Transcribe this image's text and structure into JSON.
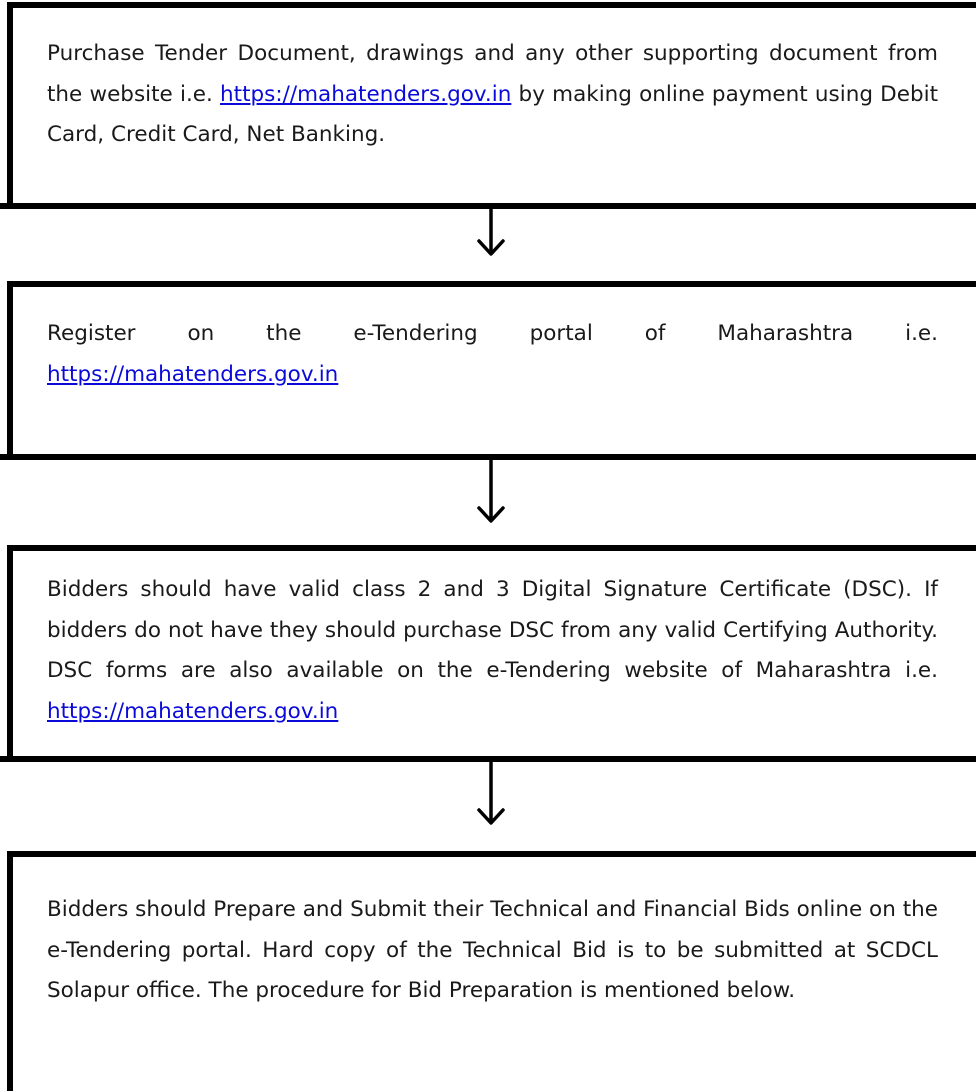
{
  "steps": [
    {
      "text_before": "Purchase Tender Document, drawings and any other supporting document from the website i.e. ",
      "link": "https://mahatenders.gov.in",
      "text_after": " by making online payment using Debit Card, Credit Card, Net Banking."
    },
    {
      "line1": "Register on the e-Tendering portal of Maharashtra i.e.",
      "link": "https://mahatenders.gov.in"
    },
    {
      "text_before": "Bidders should have valid class 2 and 3 Digital Signature Certificate (DSC). If bidders do not have they should purchase DSC from any valid Certifying Authority. DSC forms are also available on the e-Tendering website of Maharashtra i.e. ",
      "link": "https://mahatenders.gov.in"
    },
    {
      "text": "Bidders should Prepare and Submit their Technical and Financial Bids online on the e-Tendering portal. Hard copy of the Technical Bid is to be submitted at SCDCL Solapur office. The procedure for Bid Preparation is mentioned below."
    }
  ]
}
